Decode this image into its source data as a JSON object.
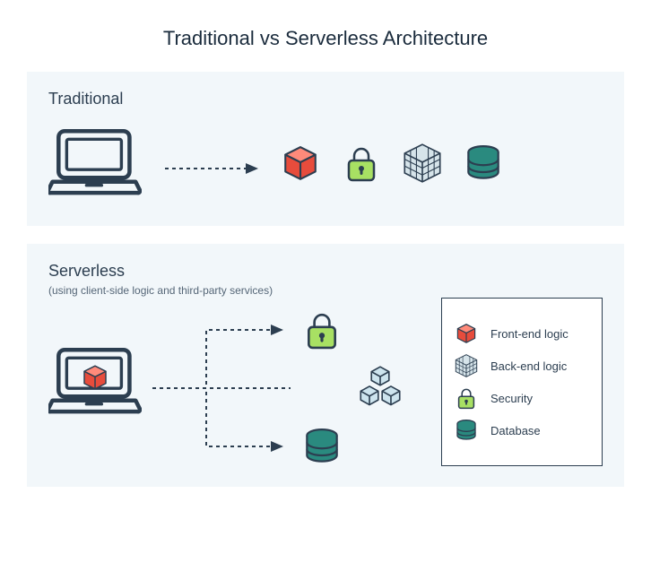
{
  "title": "Traditional vs Serverless Architecture",
  "panels": {
    "traditional": {
      "title": "Traditional"
    },
    "serverless": {
      "title": "Serverless",
      "subtitle": "(using client-side logic and third-party services)"
    }
  },
  "legend": {
    "frontend": "Front-end logic",
    "backend": "Back-end logic",
    "security": "Security",
    "database": "Database"
  }
}
